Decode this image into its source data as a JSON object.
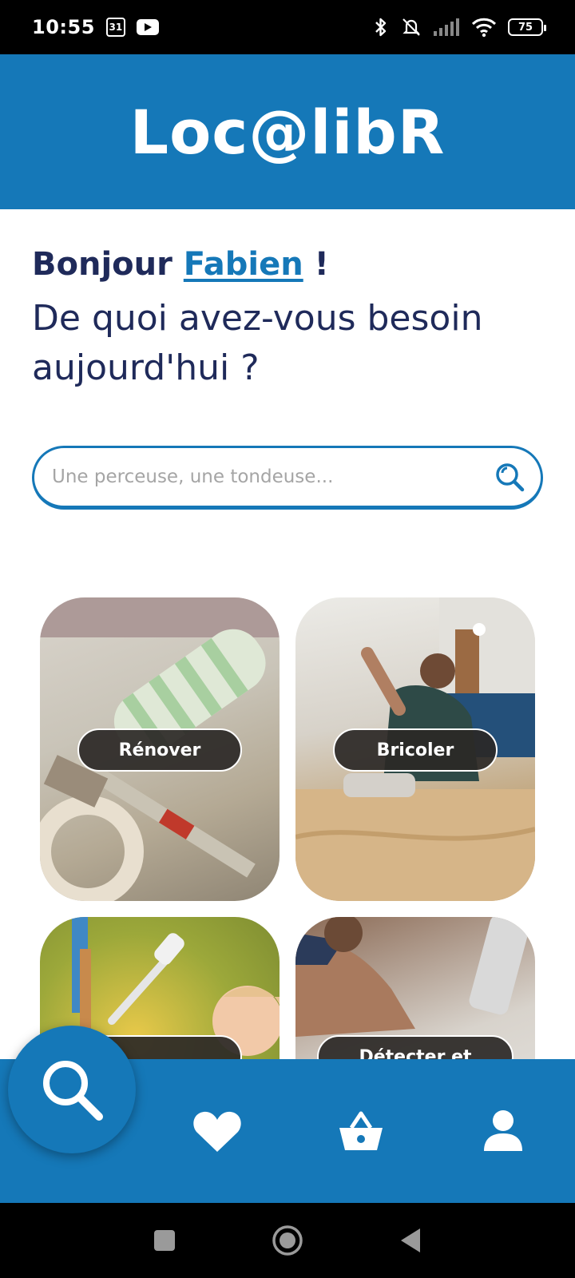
{
  "status_bar": {
    "time": "10:55",
    "calendar_day": "31",
    "battery": "75"
  },
  "header": {
    "logo": "Loc@libR",
    "brand_color": "#1578b8"
  },
  "greeting": {
    "hello": "Bonjour",
    "user_name": "Fabien",
    "exclaim": "!",
    "question": "De quoi avez-vous besoin aujourd'hui ?"
  },
  "search": {
    "placeholder": "Une perceuse, une tondeuse...",
    "icon": "search-icon"
  },
  "categories": [
    {
      "label": "Rénover"
    },
    {
      "label": "Bricoler"
    },
    {
      "label": ""
    },
    {
      "label": "Détecter et"
    }
  ],
  "bottom_nav": {
    "items": [
      {
        "icon": "search-icon"
      },
      {
        "icon": "heart-icon"
      },
      {
        "icon": "basket-icon"
      },
      {
        "icon": "user-icon"
      }
    ]
  }
}
